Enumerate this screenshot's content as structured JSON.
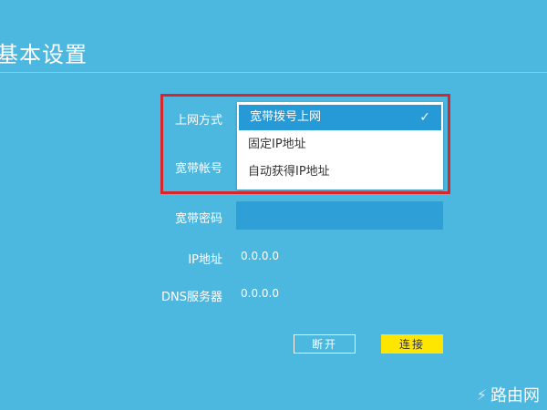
{
  "page": {
    "title": "基本设置"
  },
  "form": {
    "connection_type_label": "上网方式",
    "account_label": "宽带帐号",
    "password_label": "宽带密码",
    "ip_label": "IP地址",
    "ip_value": "0.0.0.0",
    "dns_label": "DNS服务器",
    "dns_value": "0.0.0.0"
  },
  "dropdown": {
    "options": [
      "宽带拨号上网",
      "固定IP地址",
      "自动获得IP地址"
    ],
    "selected": "宽带拨号上网",
    "check": "✓"
  },
  "buttons": {
    "disconnect": "断开",
    "connect": "连接"
  },
  "watermark": {
    "text": "路由网"
  },
  "colors": {
    "background": "#4cb8e0",
    "selected_option": "#259ad6",
    "highlight_border": "#d7272d",
    "connect_button": "#ffe600"
  }
}
